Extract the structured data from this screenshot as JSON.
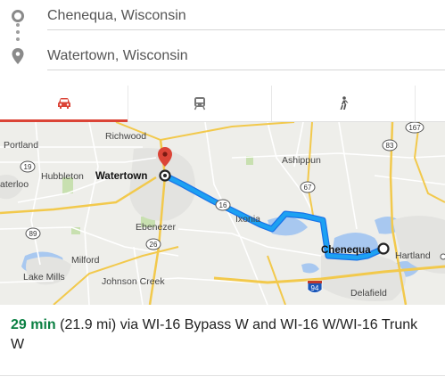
{
  "origin": {
    "value": "Chenequa, Wisconsin"
  },
  "destination": {
    "value": "Watertown, Wisconsin"
  },
  "travel_modes": [
    {
      "name": "driving",
      "active": true
    },
    {
      "name": "transit",
      "active": false
    },
    {
      "name": "walking",
      "active": false
    },
    {
      "name": "more",
      "active": false
    }
  ],
  "map": {
    "places": {
      "richwood": "Richwood",
      "portland": "Portland",
      "hubbleton": "Hubbleton",
      "terloo": "aterloo",
      "watertown": "Watertown",
      "ashippun": "Ashippun",
      "ebenezer": "Ebenezer",
      "ixonia": "Ixonia",
      "chenequa": "Chenequa",
      "hartland": "Hartland",
      "milford": "Milford",
      "lake_mills": "Lake Mills",
      "johnson_creek": "Johnson Creek",
      "delafield": "Delafield"
    },
    "shields": {
      "s19": "19",
      "s89": "89",
      "s26": "26",
      "s16": "16",
      "s67": "67",
      "s83": "83",
      "s167": "167",
      "s94": "94"
    },
    "colors": {
      "route": "#1da1f2",
      "route_outline": "#1a73e8",
      "water": "#a8c8f0",
      "park": "#c8e0b0",
      "highway": "#f2c94c"
    }
  },
  "summary": {
    "duration": "29 min",
    "details": " (21.9 mi) via WI-16 Bypass W and WI-16 W/WI-16 Trunk W"
  }
}
